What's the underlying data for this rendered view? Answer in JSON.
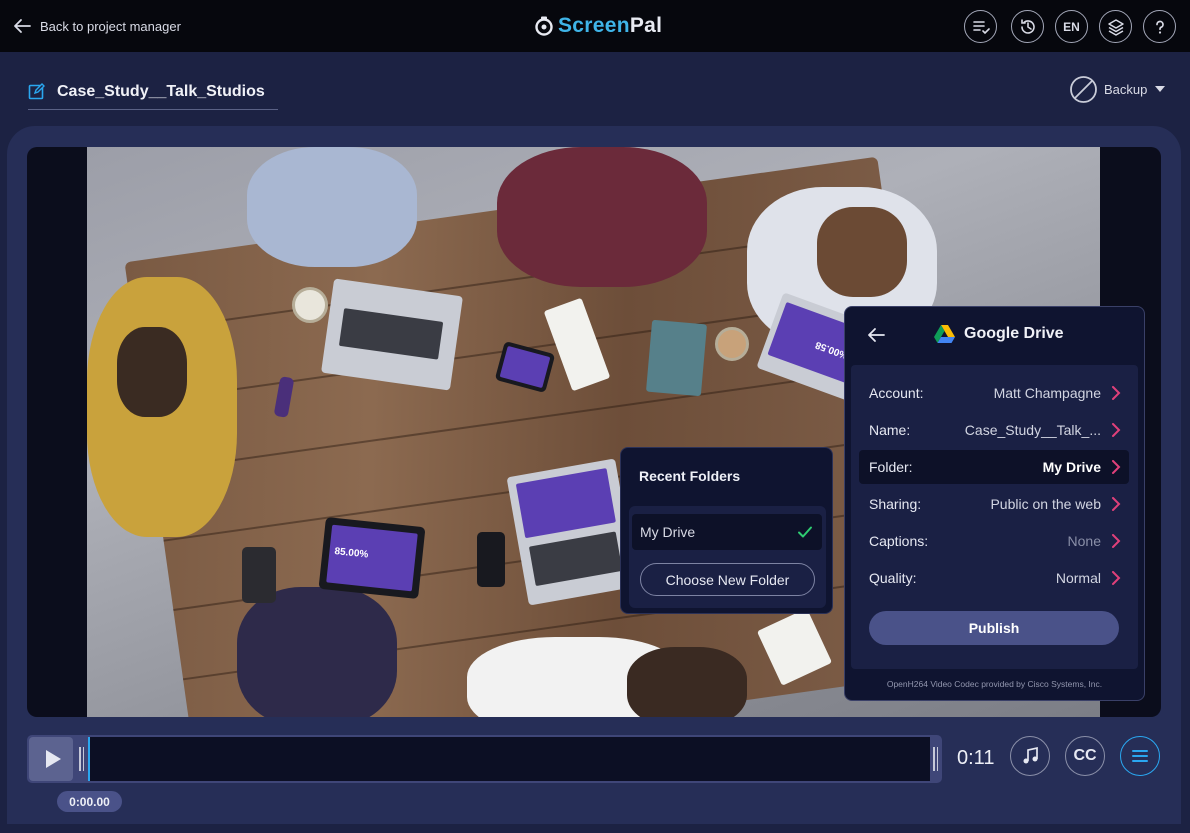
{
  "topbar": {
    "back_label": "Back to project manager",
    "logo_part1": "Screen",
    "logo_part2": "Pal",
    "language": "EN"
  },
  "project": {
    "title": "Case_Study__Talk_Studios",
    "backup_label": "Backup"
  },
  "video_overlay": {
    "tablet_text": "85.00%",
    "laptop_right_text": "%00.58"
  },
  "recent_folders": {
    "title": "Recent Folders",
    "items": [
      {
        "label": "My Drive",
        "selected": true
      }
    ],
    "choose_label": "Choose New Folder"
  },
  "drive": {
    "title": "Google Drive",
    "rows": [
      {
        "label": "Account:",
        "value": "Matt Champagne"
      },
      {
        "label": "Name:",
        "value": "Case_Study__Talk_..."
      },
      {
        "label": "Folder:",
        "value": "My Drive"
      },
      {
        "label": "Sharing:",
        "value": "Public on the web"
      },
      {
        "label": "Captions:",
        "value": "None"
      },
      {
        "label": "Quality:",
        "value": "Normal"
      }
    ],
    "publish_label": "Publish",
    "codec_note": "OpenH264 Video Codec provided by Cisco Systems, Inc."
  },
  "timeline": {
    "duration": "0:11",
    "position": "0:00.00",
    "cc_label": "CC"
  },
  "colors": {
    "accent_blue": "#2aa7f0",
    "chevron_pink": "#e0407a",
    "check_green": "#2ecc71"
  }
}
